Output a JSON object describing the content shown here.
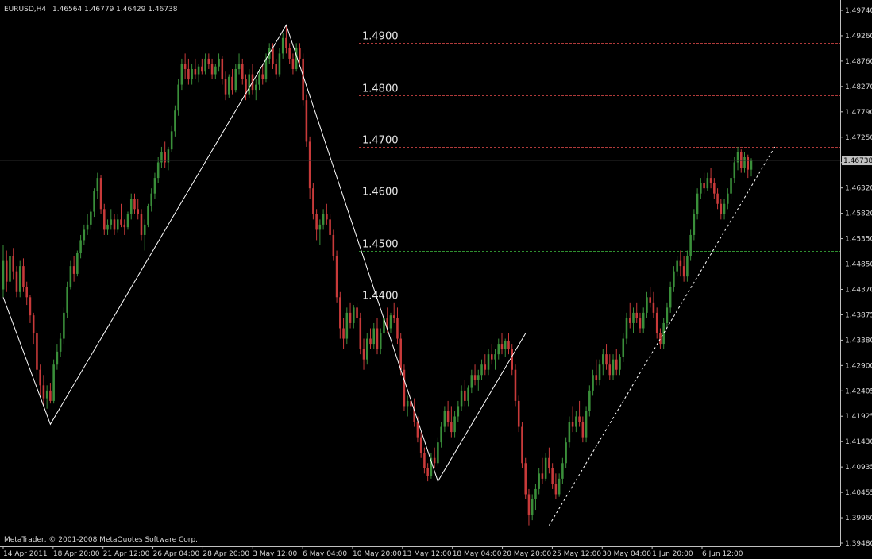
{
  "header": {
    "symbol_label": "EURUSD,H4",
    "ohlc": "1.46564 1.46779 1.46429 1.46738"
  },
  "footer": {
    "copyright": "MetaTrader, © 2001-2008 MetaQuotes Software Corp."
  },
  "colors": {
    "background": "#000000",
    "axis": "#c0c0c0",
    "bull_candle": "#3a8f3a",
    "bear_candle": "#c83a3a",
    "resistance_line": "#b03a3a",
    "support_line": "#2f8f2f",
    "zigzag": "#ffffff",
    "price_tag_bg": "#c0c0c0"
  },
  "chart_data": {
    "type": "candlestick",
    "symbol": "EURUSD",
    "timeframe": "H4",
    "last_price": 1.46738,
    "price_tag": "1.46738",
    "ylim": [
      1.3948,
      1.4974
    ],
    "y_ticks": [
      "1.49740",
      "1.49260",
      "1.48760",
      "1.48270",
      "1.47790",
      "1.47250",
      "1.46760",
      "1.46320",
      "1.45820",
      "1.45350",
      "1.44850",
      "1.44370",
      "1.43875",
      "1.43380",
      "1.42900",
      "1.42405",
      "1.41925",
      "1.41430",
      "1.40935",
      "1.40455",
      "1.39960",
      "1.39480"
    ],
    "x_ticks": [
      "14 Apr 2011",
      "18 Apr 20:00",
      "21 Apr 12:00",
      "26 Apr 04:00",
      "28 Apr 20:00",
      "3 May 12:00",
      "6 May 04:00",
      "10 May 20:00",
      "13 May 12:00",
      "18 May 04:00",
      "20 May 20:00",
      "25 May 12:00",
      "30 May 04:00",
      "1 Jun 20:00",
      "6 Jun 12:00"
    ],
    "horizontal_levels": [
      {
        "label": "1.4900",
        "value": 1.49,
        "kind": "resistance"
      },
      {
        "label": "1.4800",
        "value": 1.48,
        "kind": "resistance"
      },
      {
        "label": "1.4700",
        "value": 1.47,
        "kind": "resistance"
      },
      {
        "label": "1.4600",
        "value": 1.46,
        "kind": "support"
      },
      {
        "label": "1.4500",
        "value": 1.45,
        "kind": "support"
      },
      {
        "label": "1.4400",
        "value": 1.44,
        "kind": "support"
      }
    ],
    "zigzag": [
      {
        "bar": 0,
        "price": 1.441
      },
      {
        "bar": 14,
        "price": 1.4165
      },
      {
        "bar": 84,
        "price": 1.4935
      },
      {
        "bar": 129,
        "price": 1.4055
      },
      {
        "bar": 155,
        "price": 1.434
      }
    ],
    "trendline_dashed": [
      {
        "bar": 162,
        "price": 1.397
      },
      {
        "bar": 229,
        "price": 1.47
      }
    ],
    "candles": [
      [
        1.4425,
        1.451,
        1.441,
        1.448
      ],
      [
        1.448,
        1.45,
        1.442,
        1.444
      ],
      [
        1.444,
        1.4495,
        1.443,
        1.449
      ],
      [
        1.449,
        1.4505,
        1.4445,
        1.446
      ],
      [
        1.446,
        1.447,
        1.441,
        1.442
      ],
      [
        1.442,
        1.448,
        1.441,
        1.447
      ],
      [
        1.447,
        1.4485,
        1.442,
        1.443
      ],
      [
        1.443,
        1.444,
        1.4395,
        1.441
      ],
      [
        1.441,
        1.4415,
        1.436,
        1.4375
      ],
      [
        1.4375,
        1.438,
        1.432,
        1.434
      ],
      [
        1.434,
        1.4345,
        1.425,
        1.427
      ],
      [
        1.427,
        1.428,
        1.422,
        1.424
      ],
      [
        1.424,
        1.426,
        1.42,
        1.4215
      ],
      [
        1.4215,
        1.424,
        1.4195,
        1.423
      ],
      [
        1.423,
        1.4245,
        1.4205,
        1.421
      ],
      [
        1.421,
        1.429,
        1.4205,
        1.428
      ],
      [
        1.428,
        1.432,
        1.427,
        1.4305
      ],
      [
        1.4305,
        1.434,
        1.4295,
        1.433
      ],
      [
        1.433,
        1.439,
        1.432,
        1.438
      ],
      [
        1.438,
        1.444,
        1.437,
        1.443
      ],
      [
        1.443,
        1.448,
        1.4425,
        1.447
      ],
      [
        1.447,
        1.449,
        1.444,
        1.4455
      ],
      [
        1.4455,
        1.45,
        1.445,
        1.4495
      ],
      [
        1.4495,
        1.453,
        1.4485,
        1.452
      ],
      [
        1.452,
        1.455,
        1.451,
        1.454
      ],
      [
        1.454,
        1.457,
        1.453,
        1.455
      ],
      [
        1.455,
        1.458,
        1.454,
        1.4575
      ],
      [
        1.4575,
        1.462,
        1.4565,
        1.4615
      ],
      [
        1.4615,
        1.465,
        1.46,
        1.464
      ],
      [
        1.464,
        1.4645,
        1.457,
        1.458
      ],
      [
        1.458,
        1.459,
        1.453,
        1.454
      ],
      [
        1.454,
        1.456,
        1.453,
        1.455
      ],
      [
        1.455,
        1.458,
        1.454,
        1.456
      ],
      [
        1.456,
        1.457,
        1.453,
        1.454
      ],
      [
        1.454,
        1.457,
        1.4535,
        1.456
      ],
      [
        1.456,
        1.459,
        1.4545,
        1.455
      ],
      [
        1.455,
        1.456,
        1.453,
        1.4545
      ],
      [
        1.4545,
        1.4575,
        1.454,
        1.457
      ],
      [
        1.457,
        1.461,
        1.456,
        1.46
      ],
      [
        1.46,
        1.461,
        1.457,
        1.458
      ],
      [
        1.458,
        1.46,
        1.456,
        1.457
      ],
      [
        1.457,
        1.458,
        1.452,
        1.453
      ],
      [
        1.453,
        1.456,
        1.45,
        1.455
      ],
      [
        1.455,
        1.459,
        1.4545,
        1.4585
      ],
      [
        1.4585,
        1.462,
        1.4575,
        1.461
      ],
      [
        1.461,
        1.465,
        1.46,
        1.464
      ],
      [
        1.464,
        1.468,
        1.463,
        1.467
      ],
      [
        1.467,
        1.47,
        1.466,
        1.469
      ],
      [
        1.469,
        1.471,
        1.466,
        1.467
      ],
      [
        1.467,
        1.47,
        1.4655,
        1.4695
      ],
      [
        1.4695,
        1.474,
        1.469,
        1.473
      ],
      [
        1.473,
        1.478,
        1.472,
        1.477
      ],
      [
        1.477,
        1.483,
        1.476,
        1.482
      ],
      [
        1.482,
        1.487,
        1.481,
        1.486
      ],
      [
        1.486,
        1.488,
        1.483,
        1.485
      ],
      [
        1.485,
        1.487,
        1.482,
        1.483
      ],
      [
        1.483,
        1.486,
        1.482,
        1.485
      ],
      [
        1.485,
        1.487,
        1.483,
        1.484
      ],
      [
        1.484,
        1.486,
        1.4825,
        1.4855
      ],
      [
        1.4855,
        1.487,
        1.484,
        1.4845
      ],
      [
        1.4845,
        1.488,
        1.484,
        1.487
      ],
      [
        1.487,
        1.488,
        1.485,
        1.486
      ],
      [
        1.486,
        1.487,
        1.483,
        1.484
      ],
      [
        1.484,
        1.486,
        1.483,
        1.4855
      ],
      [
        1.4855,
        1.488,
        1.4845,
        1.487
      ],
      [
        1.487,
        1.4875,
        1.482,
        1.483
      ],
      [
        1.483,
        1.4845,
        1.479,
        1.48
      ],
      [
        1.48,
        1.484,
        1.4795,
        1.4835
      ],
      [
        1.4835,
        1.485,
        1.48,
        1.481
      ],
      [
        1.481,
        1.486,
        1.4805,
        1.485
      ],
      [
        1.485,
        1.488,
        1.484,
        1.486
      ],
      [
        1.486,
        1.487,
        1.482,
        1.483
      ],
      [
        1.483,
        1.484,
        1.479,
        1.48
      ],
      [
        1.48,
        1.485,
        1.4795,
        1.484
      ],
      [
        1.484,
        1.486,
        1.48,
        1.481
      ],
      [
        1.481,
        1.483,
        1.479,
        1.482
      ],
      [
        1.482,
        1.485,
        1.481,
        1.484
      ],
      [
        1.484,
        1.486,
        1.482,
        1.483
      ],
      [
        1.483,
        1.488,
        1.4825,
        1.487
      ],
      [
        1.487,
        1.49,
        1.486,
        1.489
      ],
      [
        1.489,
        1.49,
        1.485,
        1.486
      ],
      [
        1.486,
        1.487,
        1.483,
        1.484
      ],
      [
        1.484,
        1.489,
        1.4835,
        1.488
      ],
      [
        1.488,
        1.492,
        1.487,
        1.491
      ],
      [
        1.491,
        1.4935,
        1.488,
        1.489
      ],
      [
        1.489,
        1.49,
        1.486,
        1.487
      ],
      [
        1.487,
        1.488,
        1.484,
        1.485
      ],
      [
        1.485,
        1.49,
        1.4845,
        1.489
      ],
      [
        1.489,
        1.49,
        1.486,
        1.487
      ],
      [
        1.487,
        1.488,
        1.478,
        1.479
      ],
      [
        1.479,
        1.48,
        1.47,
        1.471
      ],
      [
        1.471,
        1.472,
        1.46,
        1.462
      ],
      [
        1.462,
        1.463,
        1.456,
        1.457
      ],
      [
        1.457,
        1.458,
        1.452,
        1.454
      ],
      [
        1.454,
        1.456,
        1.451,
        1.455
      ],
      [
        1.455,
        1.458,
        1.454,
        1.457
      ],
      [
        1.457,
        1.459,
        1.455,
        1.456
      ],
      [
        1.456,
        1.457,
        1.452,
        1.453
      ],
      [
        1.453,
        1.454,
        1.448,
        1.449
      ],
      [
        1.449,
        1.45,
        1.44,
        1.441
      ],
      [
        1.441,
        1.442,
        1.433,
        1.435
      ],
      [
        1.435,
        1.437,
        1.431,
        1.433
      ],
      [
        1.433,
        1.439,
        1.432,
        1.438
      ],
      [
        1.438,
        1.44,
        1.435,
        1.436
      ],
      [
        1.436,
        1.4395,
        1.435,
        1.439
      ],
      [
        1.439,
        1.44,
        1.436,
        1.437
      ],
      [
        1.437,
        1.438,
        1.43,
        1.431
      ],
      [
        1.431,
        1.433,
        1.427,
        1.429
      ],
      [
        1.429,
        1.434,
        1.428,
        1.433
      ],
      [
        1.433,
        1.435,
        1.431,
        1.432
      ],
      [
        1.432,
        1.436,
        1.431,
        1.435
      ],
      [
        1.435,
        1.437,
        1.43,
        1.431
      ],
      [
        1.431,
        1.435,
        1.43,
        1.434
      ],
      [
        1.434,
        1.438,
        1.433,
        1.437
      ],
      [
        1.437,
        1.439,
        1.434,
        1.435
      ],
      [
        1.435,
        1.438,
        1.434,
        1.4375
      ],
      [
        1.4375,
        1.44,
        1.436,
        1.437
      ],
      [
        1.437,
        1.439,
        1.432,
        1.433
      ],
      [
        1.433,
        1.434,
        1.426,
        1.427
      ],
      [
        1.427,
        1.428,
        1.419,
        1.42
      ],
      [
        1.42,
        1.422,
        1.418,
        1.421
      ],
      [
        1.421,
        1.423,
        1.419,
        1.42
      ],
      [
        1.42,
        1.4215,
        1.416,
        1.417
      ],
      [
        1.417,
        1.418,
        1.413,
        1.414
      ],
      [
        1.414,
        1.415,
        1.41,
        1.411
      ],
      [
        1.411,
        1.412,
        1.407,
        1.408
      ],
      [
        1.408,
        1.409,
        1.4055,
        1.4065
      ],
      [
        1.4065,
        1.411,
        1.406,
        1.41
      ],
      [
        1.41,
        1.412,
        1.408,
        1.409
      ],
      [
        1.409,
        1.414,
        1.4085,
        1.413
      ],
      [
        1.413,
        1.417,
        1.412,
        1.416
      ],
      [
        1.416,
        1.42,
        1.415,
        1.419
      ],
      [
        1.419,
        1.421,
        1.416,
        1.417
      ],
      [
        1.417,
        1.42,
        1.414,
        1.415
      ],
      [
        1.415,
        1.419,
        1.414,
        1.418
      ],
      [
        1.418,
        1.421,
        1.417,
        1.42
      ],
      [
        1.42,
        1.424,
        1.419,
        1.423
      ],
      [
        1.423,
        1.425,
        1.42,
        1.421
      ],
      [
        1.421,
        1.424,
        1.42,
        1.4235
      ],
      [
        1.4235,
        1.427,
        1.4225,
        1.426
      ],
      [
        1.426,
        1.428,
        1.424,
        1.425
      ],
      [
        1.425,
        1.427,
        1.423,
        1.426
      ],
      [
        1.426,
        1.429,
        1.425,
        1.428
      ],
      [
        1.428,
        1.43,
        1.426,
        1.427
      ],
      [
        1.427,
        1.431,
        1.426,
        1.43
      ],
      [
        1.43,
        1.432,
        1.428,
        1.429
      ],
      [
        1.429,
        1.431,
        1.427,
        1.43
      ],
      [
        1.43,
        1.433,
        1.429,
        1.432
      ],
      [
        1.432,
        1.434,
        1.43,
        1.431
      ],
      [
        1.431,
        1.433,
        1.4295,
        1.4325
      ],
      [
        1.4325,
        1.434,
        1.43,
        1.431
      ],
      [
        1.431,
        1.432,
        1.426,
        1.427
      ],
      [
        1.427,
        1.428,
        1.42,
        1.421
      ],
      [
        1.421,
        1.422,
        1.415,
        1.416
      ],
      [
        1.416,
        1.417,
        1.408,
        1.409
      ],
      [
        1.409,
        1.41,
        1.402,
        1.403
      ],
      [
        1.403,
        1.404,
        1.397,
        1.399
      ],
      [
        1.399,
        1.403,
        1.398,
        1.402
      ],
      [
        1.402,
        1.405,
        1.4,
        1.404
      ],
      [
        1.404,
        1.408,
        1.403,
        1.407
      ],
      [
        1.407,
        1.41,
        1.405,
        1.406
      ],
      [
        1.406,
        1.411,
        1.4055,
        1.41
      ],
      [
        1.41,
        1.412,
        1.407,
        1.408
      ],
      [
        1.408,
        1.409,
        1.404,
        1.405
      ],
      [
        1.405,
        1.407,
        1.402,
        1.403
      ],
      [
        1.403,
        1.407,
        1.4025,
        1.406
      ],
      [
        1.406,
        1.41,
        1.405,
        1.409
      ],
      [
        1.409,
        1.414,
        1.408,
        1.413
      ],
      [
        1.413,
        1.418,
        1.412,
        1.417
      ],
      [
        1.417,
        1.42,
        1.415,
        1.416
      ],
      [
        1.416,
        1.419,
        1.415,
        1.418
      ],
      [
        1.418,
        1.421,
        1.416,
        1.417
      ],
      [
        1.417,
        1.418,
        1.413,
        1.414
      ],
      [
        1.414,
        1.42,
        1.413,
        1.419
      ],
      [
        1.419,
        1.424,
        1.418,
        1.423
      ],
      [
        1.423,
        1.427,
        1.422,
        1.426
      ],
      [
        1.426,
        1.429,
        1.424,
        1.425
      ],
      [
        1.425,
        1.429,
        1.424,
        1.428
      ],
      [
        1.428,
        1.431,
        1.426,
        1.43
      ],
      [
        1.43,
        1.432,
        1.427,
        1.428
      ],
      [
        1.428,
        1.43,
        1.425,
        1.426
      ],
      [
        1.426,
        1.43,
        1.425,
        1.429
      ],
      [
        1.429,
        1.431,
        1.426,
        1.427
      ],
      [
        1.427,
        1.43,
        1.426,
        1.4295
      ],
      [
        1.4295,
        1.434,
        1.4285,
        1.433
      ],
      [
        1.433,
        1.438,
        1.432,
        1.437
      ],
      [
        1.437,
        1.44,
        1.435,
        1.436
      ],
      [
        1.436,
        1.439,
        1.434,
        1.438
      ],
      [
        1.438,
        1.44,
        1.436,
        1.437
      ],
      [
        1.437,
        1.438,
        1.434,
        1.435
      ],
      [
        1.435,
        1.439,
        1.434,
        1.438
      ],
      [
        1.438,
        1.442,
        1.437,
        1.441
      ],
      [
        1.441,
        1.443,
        1.439,
        1.44
      ],
      [
        1.44,
        1.442,
        1.437,
        1.438
      ],
      [
        1.438,
        1.439,
        1.433,
        1.434
      ],
      [
        1.434,
        1.435,
        1.431,
        1.432
      ],
      [
        1.432,
        1.437,
        1.431,
        1.436
      ],
      [
        1.436,
        1.44,
        1.435,
        1.439
      ],
      [
        1.439,
        1.444,
        1.438,
        1.443
      ],
      [
        1.443,
        1.447,
        1.442,
        1.446
      ],
      [
        1.446,
        1.449,
        1.445,
        1.448
      ],
      [
        1.448,
        1.45,
        1.445,
        1.447
      ],
      [
        1.447,
        1.449,
        1.444,
        1.445
      ],
      [
        1.445,
        1.45,
        1.444,
        1.449
      ],
      [
        1.449,
        1.454,
        1.448,
        1.453
      ],
      [
        1.453,
        1.458,
        1.452,
        1.457
      ],
      [
        1.457,
        1.462,
        1.456,
        1.461
      ],
      [
        1.461,
        1.464,
        1.46,
        1.463
      ],
      [
        1.463,
        1.465,
        1.461,
        1.462
      ],
      [
        1.462,
        1.465,
        1.4615,
        1.464
      ],
      [
        1.464,
        1.466,
        1.462,
        1.463
      ],
      [
        1.463,
        1.464,
        1.46,
        1.461
      ],
      [
        1.461,
        1.462,
        1.458,
        1.459
      ],
      [
        1.459,
        1.46,
        1.456,
        1.457
      ],
      [
        1.457,
        1.46,
        1.456,
        1.459
      ],
      [
        1.459,
        1.462,
        1.458,
        1.461
      ],
      [
        1.461,
        1.465,
        1.46,
        1.464
      ],
      [
        1.464,
        1.468,
        1.463,
        1.467
      ],
      [
        1.467,
        1.47,
        1.4655,
        1.469
      ],
      [
        1.469,
        1.4695,
        1.465,
        1.466
      ],
      [
        1.466,
        1.469,
        1.465,
        1.468
      ],
      [
        1.468,
        1.4685,
        1.464,
        1.4656
      ],
      [
        1.4656,
        1.4678,
        1.4643,
        1.4674
      ]
    ]
  }
}
